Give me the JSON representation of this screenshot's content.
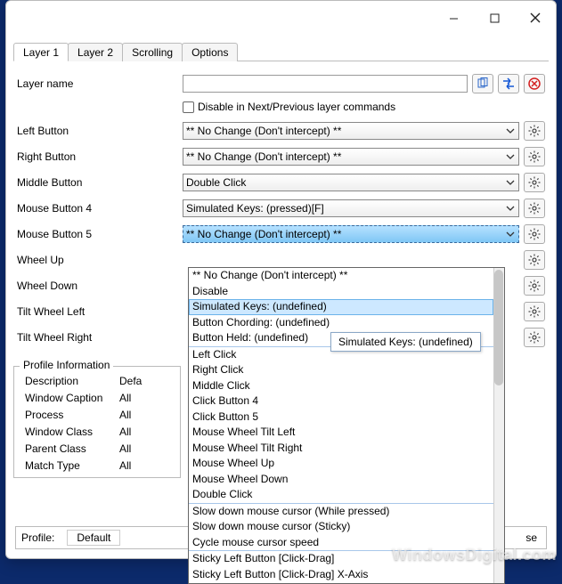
{
  "titlebar": {},
  "tabs": [
    "Layer 1",
    "Layer 2",
    "Scrolling",
    "Options"
  ],
  "active_tab": 0,
  "layer_name": {
    "label": "Layer name",
    "value": ""
  },
  "disable_checkbox": "Disable in Next/Previous layer commands",
  "button_rows": [
    {
      "label": "Left Button",
      "value": "** No Change (Don't intercept) **"
    },
    {
      "label": "Right Button",
      "value": "** No Change (Don't intercept) **"
    },
    {
      "label": "Middle Button",
      "value": "Double Click"
    },
    {
      "label": "Mouse Button 4",
      "value": "Simulated Keys: (pressed)[F]"
    },
    {
      "label": "Mouse Button 5",
      "value": "** No Change (Don't intercept) **",
      "open": true
    },
    {
      "label": "Wheel Up",
      "value": ""
    },
    {
      "label": "Wheel Down",
      "value": ""
    },
    {
      "label": "Tilt Wheel Left",
      "value": ""
    },
    {
      "label": "Tilt Wheel Right",
      "value": ""
    }
  ],
  "dropdown": {
    "highlight_index": 2,
    "tooltip": "Simulated Keys: (undefined)",
    "groups": [
      [
        "** No Change (Don't intercept) **",
        "Disable",
        "Simulated Keys: (undefined)",
        "Button Chording: (undefined)",
        "Button Held: (undefined)"
      ],
      [
        "Left Click",
        "Right Click",
        "Middle Click",
        "Click Button 4",
        "Click Button 5",
        "Mouse Wheel Tilt Left",
        "Mouse Wheel Tilt Right",
        "Mouse Wheel Up",
        "Mouse Wheel Down",
        "Double Click"
      ],
      [
        "Slow down mouse cursor (While pressed)",
        "Slow down mouse cursor (Sticky)",
        "Cycle mouse cursor speed"
      ],
      [
        "Sticky Left Button [Click-Drag]",
        "Sticky Left Button [Click-Drag] X-Axis"
      ]
    ]
  },
  "profile_info": {
    "title": "Profile Information",
    "rows": [
      {
        "k": "Description",
        "v": "Defa"
      },
      {
        "k": "Window Caption",
        "v": "All"
      },
      {
        "k": "Process",
        "v": "All"
      },
      {
        "k": "Window Class",
        "v": "All"
      },
      {
        "k": "Parent Class",
        "v": "All"
      },
      {
        "k": "Match Type",
        "v": "All"
      }
    ]
  },
  "statusbar": {
    "profile_label": "Profile:",
    "profile_value": "Default",
    "suffix": "se"
  },
  "watermark": "WindowsDigital.com"
}
